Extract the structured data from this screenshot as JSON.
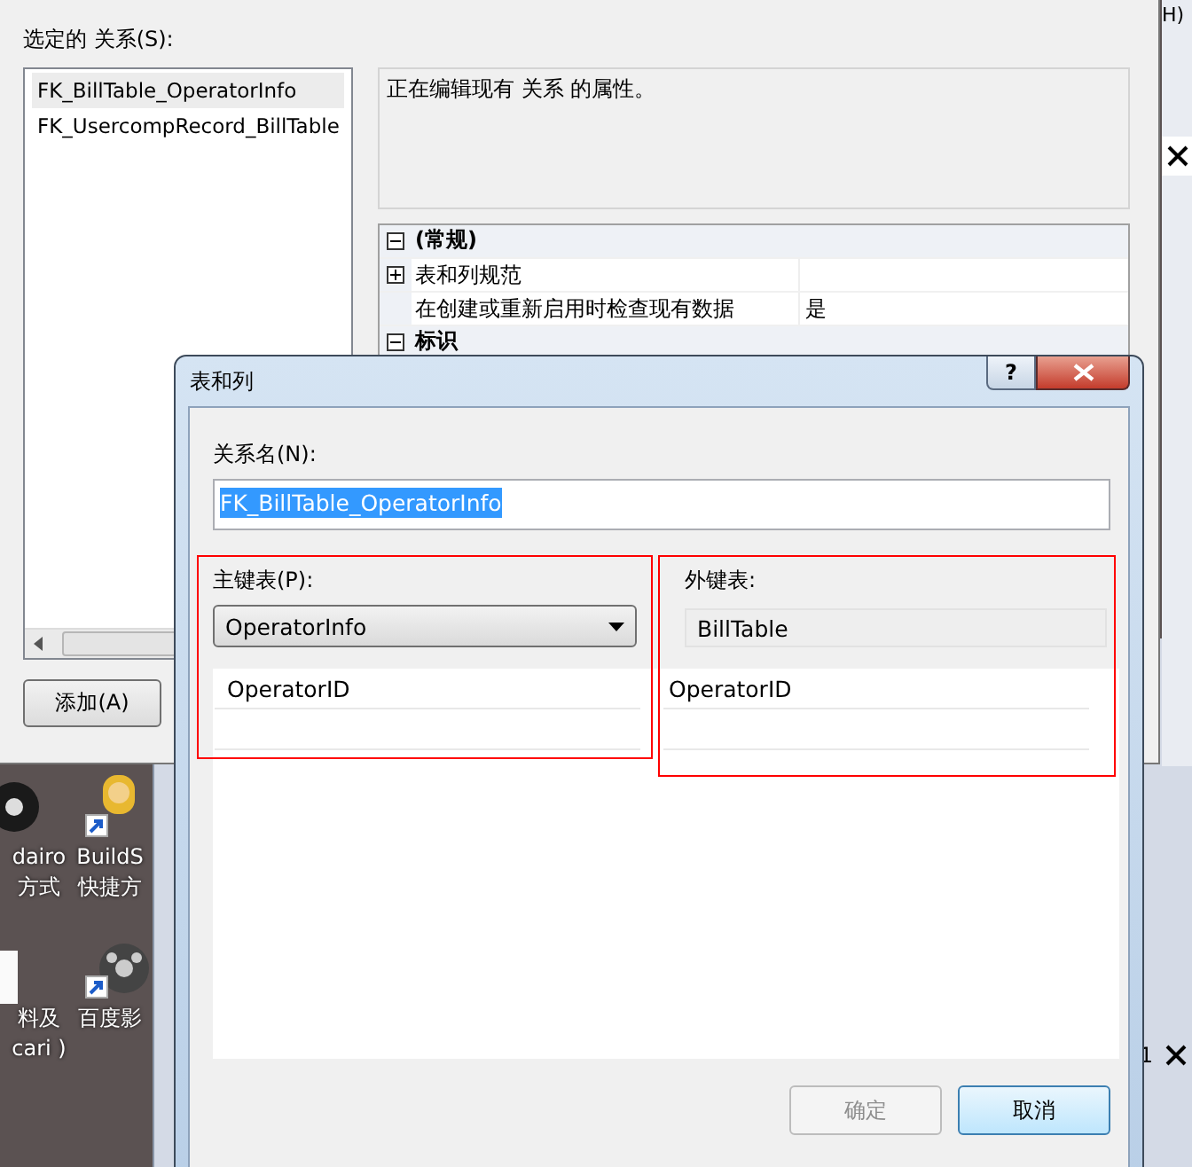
{
  "back_dialog": {
    "relations_label": "选定的 关系(S):",
    "relations": [
      {
        "name": "FK_BillTable_OperatorInfo",
        "selected": true
      },
      {
        "name": "FK_UsercompRecord_BillTable",
        "selected": false
      }
    ],
    "description": "正在编辑现有 关系 的属性。",
    "properties": [
      {
        "kind": "category",
        "label": "(常规)",
        "expanded": true
      },
      {
        "kind": "property",
        "label": "表和列规范",
        "expandable": true,
        "expanded": false
      },
      {
        "kind": "property",
        "label": "在创建或重新启用时检查现有数据",
        "expandable": false,
        "value": "是"
      },
      {
        "kind": "category",
        "label": "标识",
        "expanded": true
      }
    ],
    "add_button": "添加(A)"
  },
  "behind_window": {
    "top_label": "H)",
    "corner_text": "1"
  },
  "desktop_icons": [
    {
      "kind": "disc",
      "shortcut": false,
      "lines": [
        "dairo",
        "方式"
      ]
    },
    {
      "kind": "person",
      "shortcut": true,
      "lines": [
        "BuildS",
        "快捷方"
      ]
    },
    {
      "kind": "page",
      "shortcut": false,
      "lines": [
        "料及",
        "cari )"
      ]
    },
    {
      "kind": "film",
      "shortcut": true,
      "lines": [
        "百度影"
      ]
    }
  ],
  "dialog": {
    "title": "表和列",
    "help_glyph": "?",
    "name_label": "关系名(N):",
    "name_value": "FK_BillTable_OperatorInfo",
    "name_selected": true,
    "primary": {
      "label": "主键表(P):",
      "table": "OperatorInfo",
      "columns": [
        "OperatorID"
      ]
    },
    "foreign": {
      "label": "外键表:",
      "table": "BillTable",
      "columns": [
        "OperatorID"
      ]
    },
    "buttons": [
      {
        "label": "确定",
        "disabled": true,
        "default": false
      },
      {
        "label": "取消",
        "disabled": false,
        "default": true
      }
    ]
  }
}
